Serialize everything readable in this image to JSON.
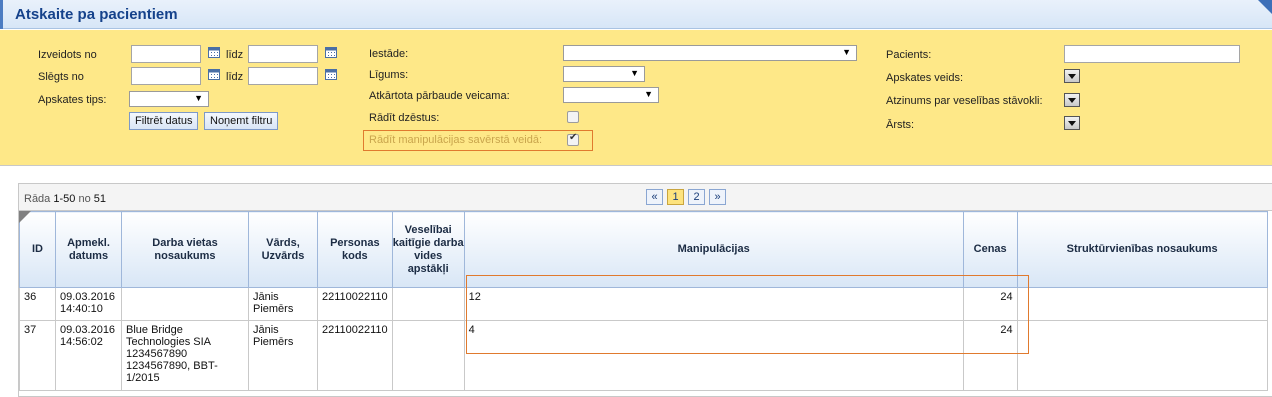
{
  "title": "Atskaite pa pacientiem",
  "filters": {
    "izveidots_no": "Izveidots no",
    "lidz1": "līdz",
    "slegts_no": "Slēgts no",
    "lidz2": "līdz",
    "apskates_tips": "Apskates tips:",
    "filtret": "Filtrēt datus",
    "nonemt": "Noņemt filtru",
    "iestade": "Iestāde:",
    "ligums": "Līgums:",
    "atkartota": "Atkārtota pārbaude veicama:",
    "radit_dzestus": "Rādīt dzēstus:",
    "radit_manip": "Rādīt manipulācijas savērstā veidā:",
    "pacients": "Pacients:",
    "apskates_veids": "Apskates veids:",
    "atzinums": "Atzinums par veselības stāvokli:",
    "arsts": "Ārsts:"
  },
  "grid": {
    "rada_prefix": "Rāda",
    "rada_range": "1-50",
    "rada_no": "no",
    "rada_total": "51",
    "pager": [
      "«",
      "1",
      "2",
      "»"
    ],
    "columns": [
      "ID",
      "Apmekl. datums",
      "Darba vietas nosaukums",
      "Vārds, Uzvārds",
      "Personas kods",
      "Veselībai kaitīgie darba vides apstākļi",
      "Manipulācijas",
      "Cenas",
      "Struktūrvienības nosaukums"
    ],
    "rows": [
      {
        "id": "36",
        "datums": "09.03.2016 14:40:10",
        "darba_vieta": "",
        "vards": "Jānis Piemērs",
        "kods": "22110022110",
        "apstakli": "",
        "manip": "12",
        "cenas": "24",
        "struktura": ""
      },
      {
        "id": "37",
        "datums": "09.03.2016 14:56:02",
        "darba_vieta": "Blue Bridge Technologies SIA 1234567890 1234567890, BBT-1/2015",
        "vards": "Jānis Piemērs",
        "kods": "22110022110",
        "apstakli": "",
        "manip": "4",
        "cenas": "24",
        "struktura": ""
      }
    ]
  }
}
